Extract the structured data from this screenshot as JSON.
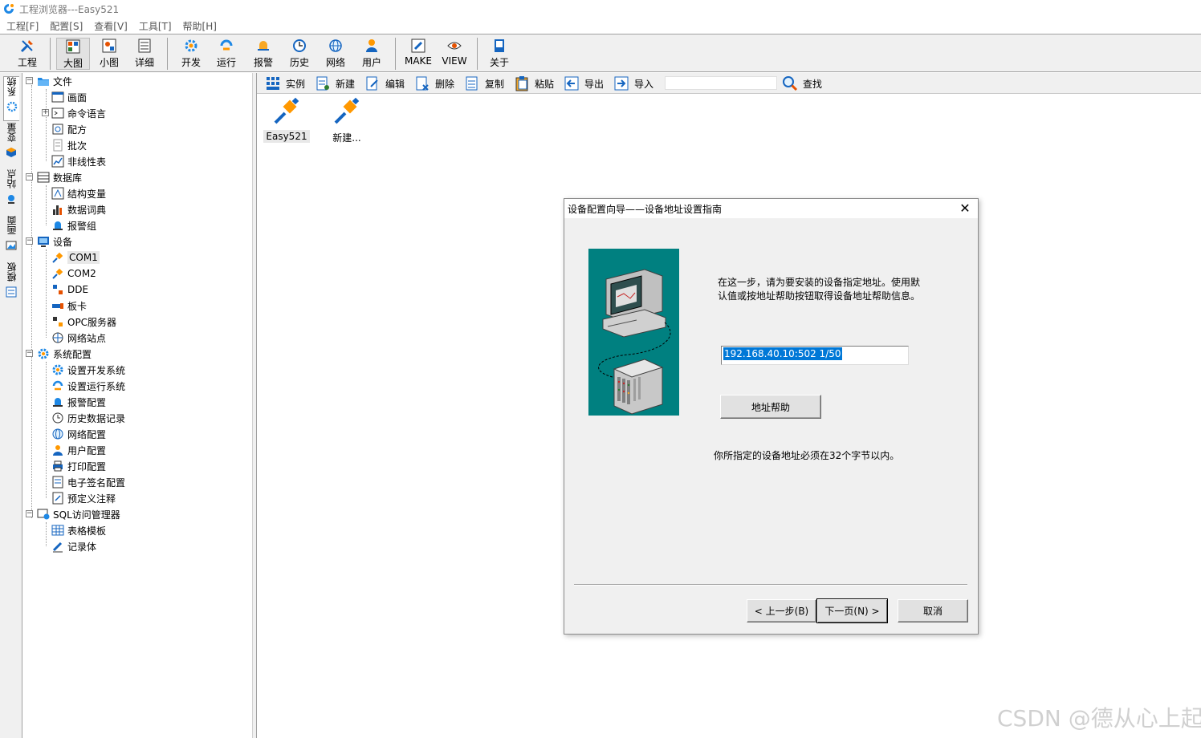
{
  "window": {
    "title": "工程浏览器---Easy521"
  },
  "menubar": {
    "items": [
      "工程[F]",
      "配置[S]",
      "查看[V]",
      "工具[T]",
      "帮助[H]"
    ]
  },
  "toolbar": {
    "project": "工程",
    "big_icon": "大图",
    "small_icon": "小图",
    "detail": "详细",
    "develop": "开发",
    "run": "运行",
    "alarm": "报警",
    "history": "历史",
    "network": "网络",
    "user": "用户",
    "make": "MAKE",
    "view": "VIEW",
    "about": "关于"
  },
  "vtabs": [
    "系统",
    "变量",
    "站点",
    "画面",
    "模板"
  ],
  "tree": {
    "file": "文件",
    "screen": "画面",
    "command_language": "命令语言",
    "recipe": "配方",
    "batch": "批次",
    "nonlinear_table": "非线性表",
    "database": "数据库",
    "struct_var": "结构变量",
    "data_dict": "数据词典",
    "alarm_group": "报警组",
    "device": "设备",
    "com1": "COM1",
    "com2": "COM2",
    "dde": "DDE",
    "board": "板卡",
    "opc_server": "OPC服务器",
    "net_station": "网络站点",
    "sys_config": "系统配置",
    "dev_sys": "设置开发系统",
    "run_sys": "设置运行系统",
    "alarm_config": "报警配置",
    "history_record": "历史数据记录",
    "net_config": "网络配置",
    "user_config": "用户配置",
    "print_config": "打印配置",
    "esign_config": "电子签名配置",
    "predef_comment": "预定义注释",
    "sql_manager": "SQL访问管理器",
    "table_template": "表格模板",
    "record_body": "记录体"
  },
  "right_toolbar": {
    "instance": "实例",
    "new": "新建",
    "edit": "编辑",
    "delete": "删除",
    "copy": "复制",
    "paste": "粘贴",
    "export": "导出",
    "import": "导入",
    "find": "查找"
  },
  "devices": [
    {
      "label": "Easy521"
    },
    {
      "label": "新建..."
    }
  ],
  "dialog": {
    "title": "设备配置向导——设备地址设置指南",
    "desc_line1": "在这一步，请为要安装的设备指定地址。使用默",
    "desc_line2": "认值或按地址帮助按钮取得设备地址帮助信息。",
    "address_value": "192.168.40.10:502 1/50",
    "address_help": "地址帮助",
    "note": "你所指定的设备地址必须在32个字节以内。",
    "prev": "< 上一步(B)",
    "next": "下一页(N) >",
    "cancel": "取消"
  },
  "watermark": "CSDN @德从心上起",
  "colors": {
    "teal": "#008080",
    "selection": "#0078d7",
    "toolbar_bg": "#f0f0f0"
  }
}
